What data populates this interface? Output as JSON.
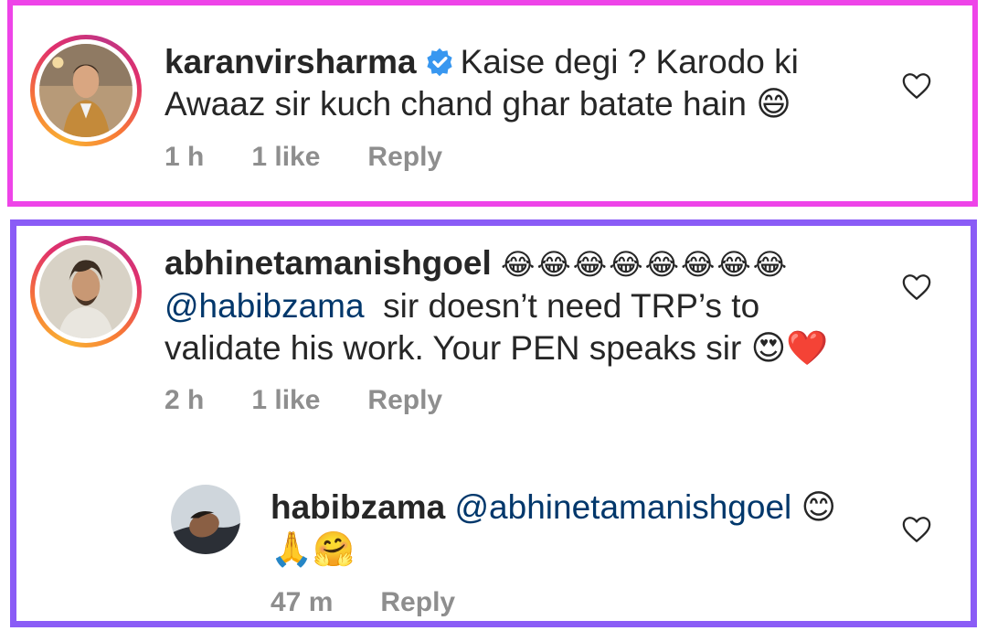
{
  "colors": {
    "frame1_border": "#ee44e8",
    "frame2_border": "#8a5cf6",
    "text": "#262626",
    "muted": "#8e8e8e",
    "mention": "#00376b",
    "verified": "#3897f0"
  },
  "comments": [
    {
      "username": "karanvirsharma",
      "verified": true,
      "text_line1": "Kaise degi ? Karodo ki",
      "text_line2": "Awaaz sir kuch chand ghar batate hain 😄",
      "time": "1 h",
      "likes": "1 like",
      "reply": "Reply"
    },
    {
      "username": "abhinetamanishgoel",
      "emojis": "😂😂😂😂😂😂😂😂",
      "mention": "@habibzama",
      "text_line2_rest": "sir doesn’t need TRP’s to",
      "text_line3": "validate his work. Your PEN speaks sir 😍❤️",
      "time": "2 h",
      "likes": "1 like",
      "reply": "Reply"
    },
    {
      "username": "habibzama",
      "mention": "@abhinetamanishgoel",
      "emoji_after": "😊",
      "text_line2": "🙏🤗",
      "time": "47 m",
      "reply": "Reply"
    }
  ],
  "icons": {
    "like": "heart-outline-icon",
    "verified": "verified-badge-icon"
  }
}
